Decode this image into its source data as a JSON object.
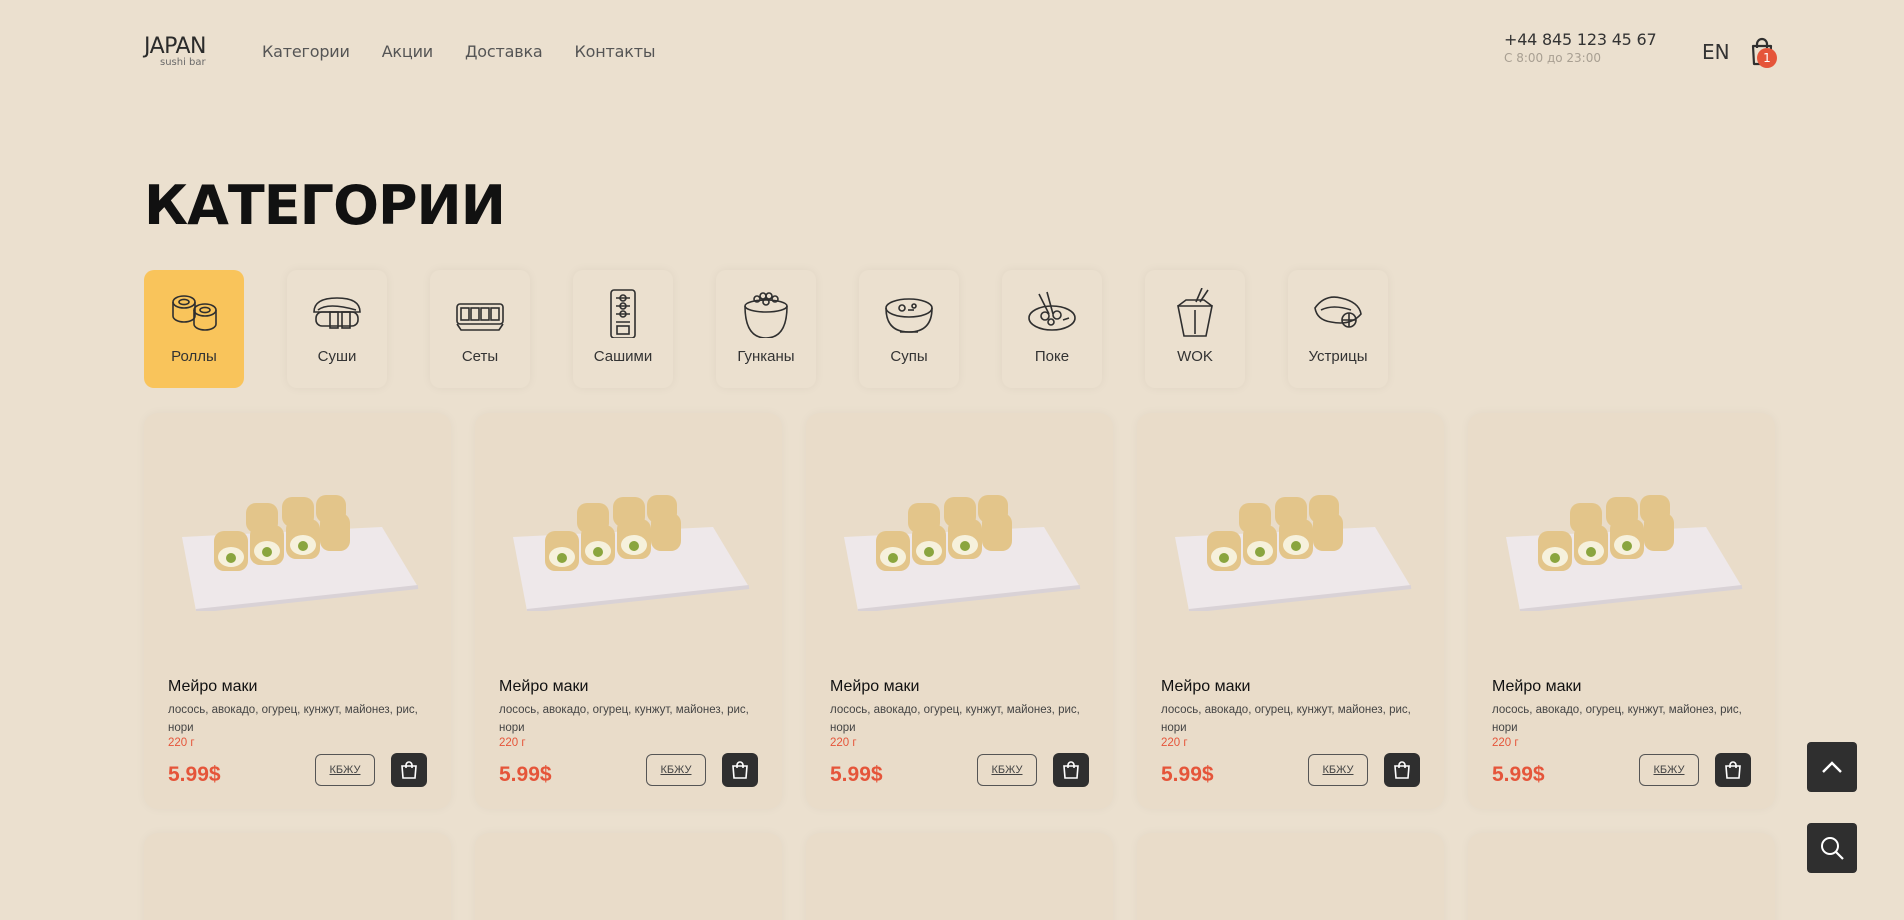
{
  "header": {
    "logo_main": "JAPAN",
    "logo_sub": "sushi bar",
    "nav": [
      "Категории",
      "Акции",
      "Доставка",
      "Контакты"
    ],
    "phone": "+44 845 123 45 67",
    "hours": "С 8:00 до 23:00",
    "lang": "EN",
    "cart_count": "1"
  },
  "page_title": "КАТЕГОРИИ",
  "categories": [
    {
      "label": "Роллы",
      "icon": "rolls-icon",
      "active": true
    },
    {
      "label": "Суши",
      "icon": "sushi-icon"
    },
    {
      "label": "Сеты",
      "icon": "sets-icon"
    },
    {
      "label": "Сашими",
      "icon": "sashimi-icon"
    },
    {
      "label": "Гунканы",
      "icon": "gunkan-icon"
    },
    {
      "label": "Супы",
      "icon": "soup-icon"
    },
    {
      "label": "Поке",
      "icon": "poke-icon"
    },
    {
      "label": "WOK",
      "icon": "wok-icon"
    },
    {
      "label": "Устрицы",
      "icon": "oysters-icon"
    }
  ],
  "products": [
    {
      "title": "Мейро маки",
      "desc": "лосось, авокадо, огурец, кунжут, майонез, рис, нори",
      "weight": "220 г",
      "price": "5.99$",
      "kbju": "КБЖУ"
    },
    {
      "title": "Мейро маки",
      "desc": "лосось, авокадо, огурец, кунжут, майонез, рис, нори",
      "weight": "220 г",
      "price": "5.99$",
      "kbju": "КБЖУ"
    },
    {
      "title": "Мейро маки",
      "desc": "лосось, авокадо, огурец, кунжут, майонез, рис, нори",
      "weight": "220 г",
      "price": "5.99$",
      "kbju": "КБЖУ"
    },
    {
      "title": "Мейро маки",
      "desc": "лосось, авокадо, огурец, кунжут, майонез, рис, нори",
      "weight": "220 г",
      "price": "5.99$",
      "kbju": "КБЖУ"
    },
    {
      "title": "Мейро маки",
      "desc": "лосось, авокадо, огурец, кунжут, майонез, рис, нори",
      "weight": "220 г",
      "price": "5.99$",
      "kbju": "КБЖУ"
    }
  ],
  "colors": {
    "accent": "#e5553a",
    "active_category": "#f9c45b",
    "background": "#ebe0cf",
    "dark_button": "#2f2f2f"
  },
  "floating": [
    "scroll-up-icon",
    "search-icon"
  ]
}
